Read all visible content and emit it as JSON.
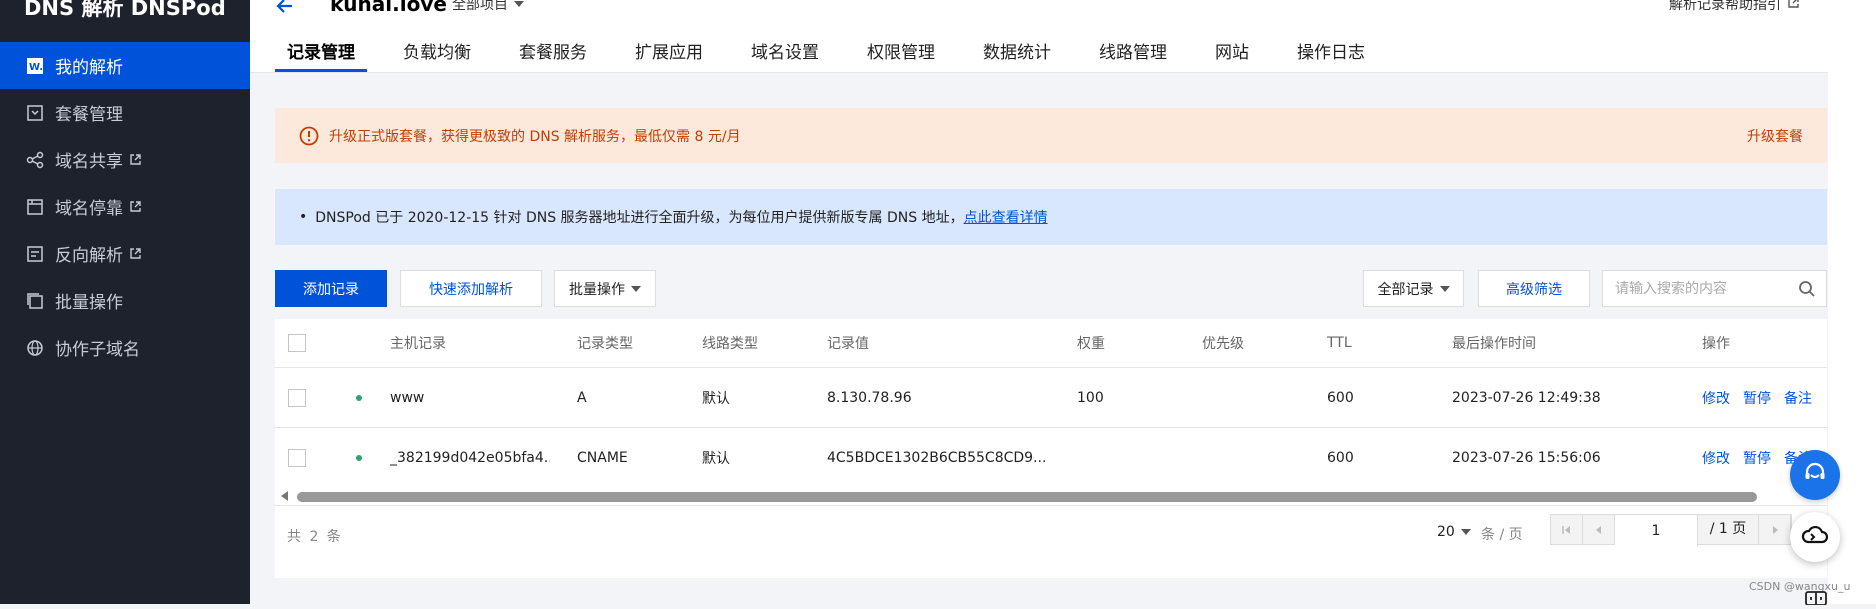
{
  "brand": "DNS 解析 DNSPod",
  "sidebar": {
    "items": [
      {
        "label": "我的解析",
        "icon": "w-logo-icon",
        "external": false,
        "active": true
      },
      {
        "label": "套餐管理",
        "icon": "package-icon",
        "external": false,
        "active": false
      },
      {
        "label": "域名共享",
        "icon": "share-icon",
        "external": true,
        "active": false
      },
      {
        "label": "域名停靠",
        "icon": "parking-icon",
        "external": true,
        "active": false
      },
      {
        "label": "反向解析",
        "icon": "reverse-icon",
        "external": true,
        "active": false
      },
      {
        "label": "批量操作",
        "icon": "batch-icon",
        "external": false,
        "active": false
      },
      {
        "label": "协作子域名",
        "icon": "globe-icon",
        "external": false,
        "active": false
      }
    ]
  },
  "header": {
    "domain": "kuhai.love",
    "project": "全部项目",
    "help": "解析记录帮助指引",
    "tabs": [
      "记录管理",
      "负载均衡",
      "套餐服务",
      "扩展应用",
      "域名设置",
      "权限管理",
      "数据统计",
      "线路管理",
      "网站",
      "操作日志"
    ],
    "active_tab": 0
  },
  "warn_banner": {
    "text": "升级正式版套餐，获得更极致的 DNS 解析服务，最低仅需 8 元/月",
    "action": "升级套餐"
  },
  "info_banner": {
    "bullet": "•",
    "text": "DNSPod 已于 2020-12-15 针对 DNS 服务器地址进行全面升级，为每位用户提供新版专属 DNS 地址，",
    "link": "点此查看详情"
  },
  "toolbar": {
    "add": "添加记录",
    "quick_add": "快速添加解析",
    "batch": "批量操作",
    "filter": "全部记录",
    "advanced": "高级筛选",
    "search_placeholder": "请输入搜索的内容"
  },
  "table": {
    "columns": [
      "主机记录",
      "记录类型",
      "线路类型",
      "记录值",
      "权重",
      "优先级",
      "TTL",
      "最后操作时间",
      "操作"
    ],
    "rows": [
      {
        "host": "www",
        "type": "A",
        "line": "默认",
        "value": "8.130.78.96",
        "weight": "100",
        "priority": "",
        "ttl": "600",
        "time": "2023-07-26 12:49:38",
        "ops": [
          "修改",
          "暂停",
          "备注"
        ],
        "status_color": "#2ba471"
      },
      {
        "host": "_382199d042e05bfa4...",
        "type": "CNAME",
        "line": "默认",
        "value": "4C5BDCE1302B6CB55C8CD9...",
        "weight": "",
        "priority": "",
        "ttl": "600",
        "time": "2023-07-26 15:56:06",
        "ops": [
          "修改",
          "暂停",
          "备注"
        ],
        "status_color": "#2ba471"
      }
    ]
  },
  "footer": {
    "total": "共 2 条",
    "page_size": "20",
    "per_page": "条 / 页",
    "current_page": "1",
    "total_pages": "/ 1 页"
  },
  "watermark": "CSDN @wangxu_u",
  "colors": {
    "primary": "#0052d9",
    "warn_bg": "#fde8dc",
    "warn_text": "#c23e00",
    "info_bg": "#d8e7fd",
    "sidebar_bg": "#1e222d"
  }
}
